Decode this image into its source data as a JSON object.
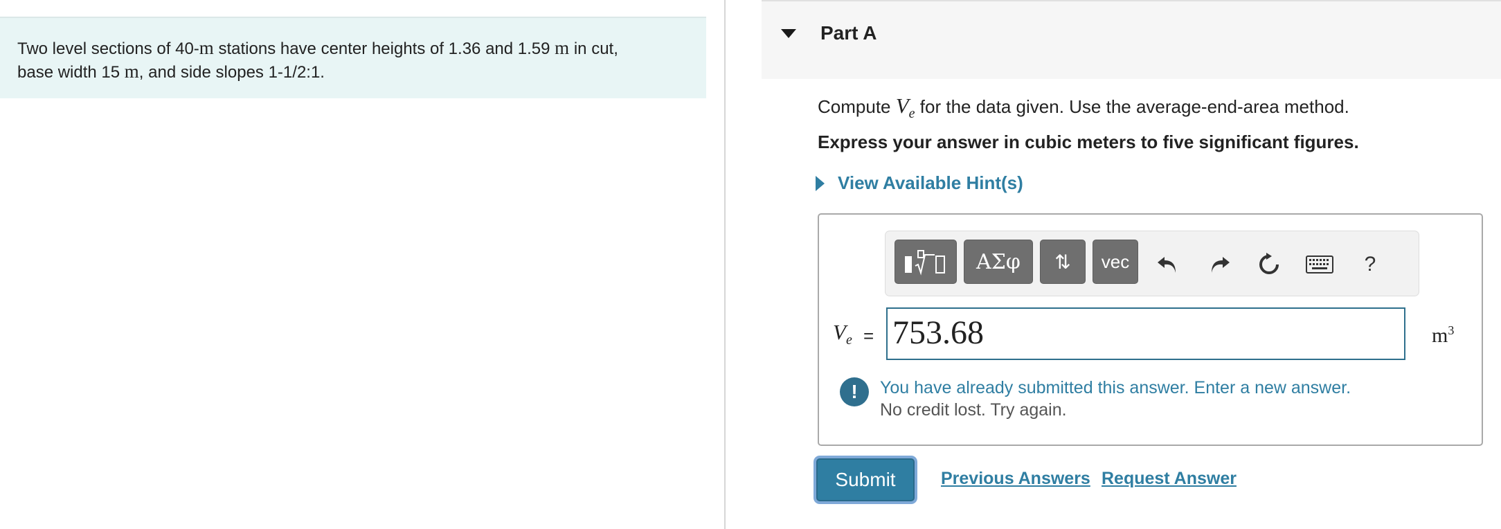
{
  "problem": {
    "text_1": "Two level sections of 40-",
    "unit_m": "m",
    "text_2": " stations have center heights of 1.36 and 1.59 ",
    "text_3": " in cut,",
    "text_4": "base width 15 ",
    "text_5": ", and side slopes 1-1/2:1."
  },
  "part": {
    "title": "Part A"
  },
  "question": {
    "compute_prefix": "Compute ",
    "var_letter": "V",
    "var_sub": "e",
    "compute_suffix": " for the data given. Use the average-end-area method.",
    "express": "Express your answer in cubic meters to five significant figures."
  },
  "hints": {
    "label": "View Available Hint(s)"
  },
  "toolbar": {
    "greek_label": "ΑΣφ",
    "arrows_label": "⇅",
    "vec_label": "vec",
    "help_label": "?"
  },
  "answer": {
    "equals": "=",
    "value": "753.68",
    "unit": "m",
    "unit_exp": "3"
  },
  "feedback": {
    "icon": "!",
    "main": "You have already submitted this answer. Enter a new answer.",
    "sub": "No credit lost. Try again."
  },
  "actions": {
    "submit": "Submit",
    "previous": "Previous Answers",
    "request": "Request Answer"
  },
  "colors": {
    "accent": "#2f7ea2",
    "problem_bg": "#e8f5f5",
    "button_gray": "#6f6f6f"
  }
}
